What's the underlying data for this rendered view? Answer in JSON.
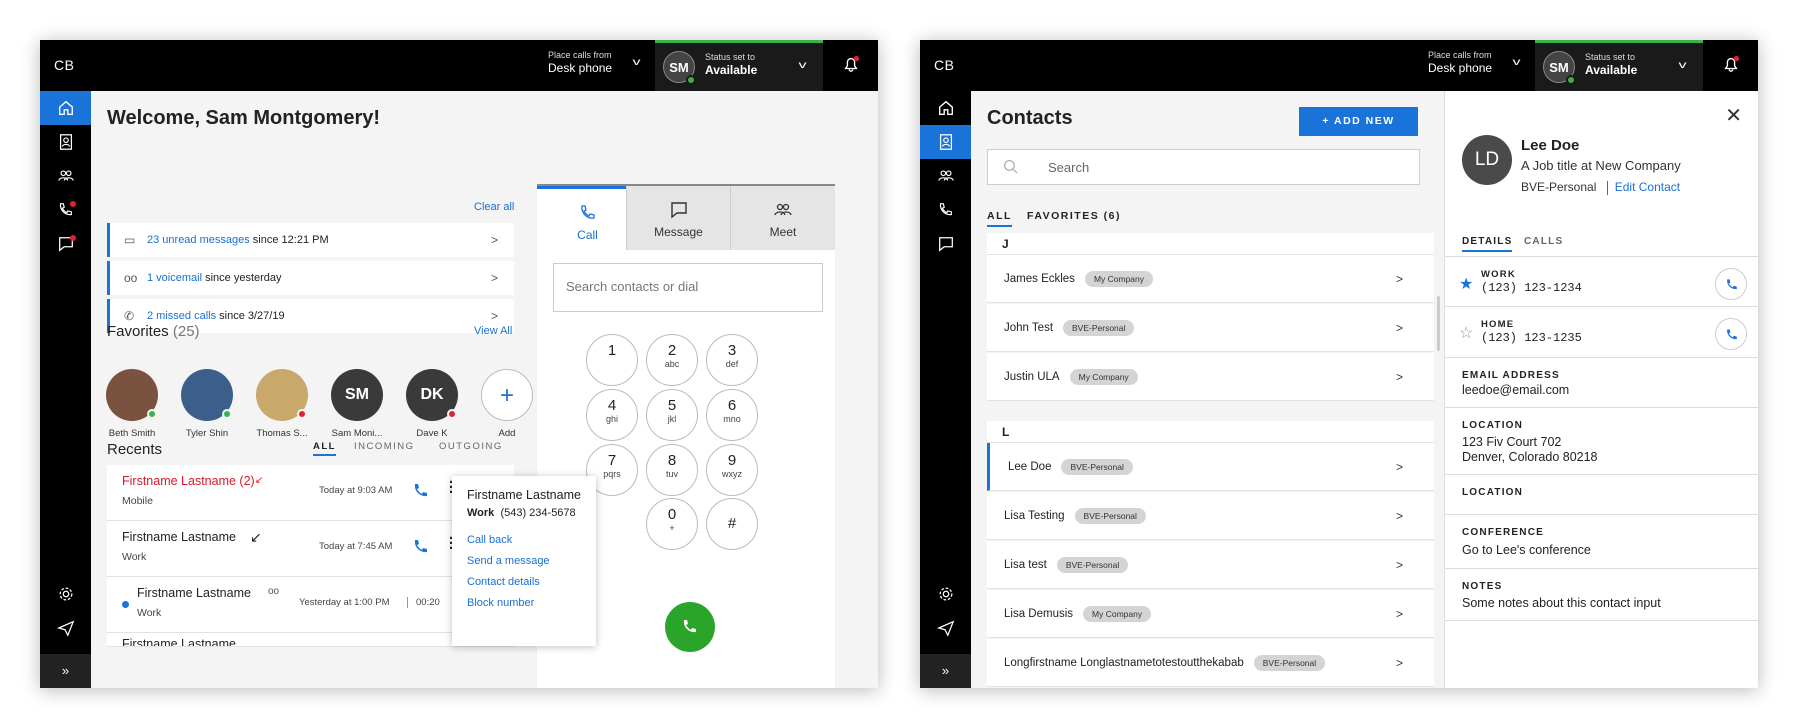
{
  "colors": {
    "accent": "#1a73d9",
    "available": "#3cb34a",
    "busy": "#e0212f",
    "call": "#2aa52a"
  },
  "left": {
    "logo": "CB",
    "place_label": "Place calls from",
    "place_value": "Desk phone",
    "status_initials": "SM",
    "status_label": "Status set to",
    "status_value": "Available",
    "welcome": "Welcome, Sam Montgomery!",
    "clear_all": "Clear all",
    "notifications": [
      {
        "link": "23 unread messages",
        "rest": "since 12:21 PM",
        "icon": "message-icon"
      },
      {
        "link": "1 voicemail",
        "rest": "since yesterday",
        "icon": "voicemail-icon"
      },
      {
        "link": "2 missed calls",
        "rest": "since 3/27/19",
        "icon": "missed-call-icon"
      }
    ],
    "favorites_title": "Favorites",
    "favorites_count": "(25)",
    "view_all": "View All",
    "favorites": [
      {
        "name": "Beth Smith",
        "status": "available"
      },
      {
        "name": "Tyler Shin",
        "status": "available"
      },
      {
        "name": "Thomas S...",
        "status": "busy"
      },
      {
        "name": "Sam Moni...",
        "initials": "SM"
      },
      {
        "name": "Dave K",
        "initials": "DK",
        "status": "busy"
      },
      {
        "name": "Add"
      }
    ],
    "recents_title": "Recents",
    "recent_tabs": [
      "ALL",
      "INCOMING",
      "OUTGOING"
    ],
    "recents": [
      {
        "name": "Firstname Lastname (2)",
        "type": "Mobile",
        "time": "Today at 9:03 AM"
      },
      {
        "name": "Firstname Lastname",
        "type": "Work",
        "time": "Today at 7:45 AM"
      },
      {
        "name": "Firstname Lastname",
        "type": "Work",
        "time": "Yesterday at 1:00 PM",
        "duration": "00:20"
      },
      {
        "name": "Firstname Lastname"
      }
    ],
    "popup": {
      "name": "Firstname Lastname",
      "type": "Work",
      "number": "(543) 234-5678",
      "actions": [
        "Call back",
        "Send a message",
        "Contact details",
        "Block number"
      ]
    },
    "dial_tabs": [
      "Call",
      "Message",
      "Meet"
    ],
    "dial_placeholder": "Search contacts or dial",
    "keys": [
      [
        "1",
        ""
      ],
      [
        "2",
        "abc"
      ],
      [
        "3",
        "def"
      ],
      [
        "4",
        "ghi"
      ],
      [
        "5",
        "jkl"
      ],
      [
        "6",
        "mno"
      ],
      [
        "7",
        "pqrs"
      ],
      [
        "8",
        "tuv"
      ],
      [
        "9",
        "wxyz"
      ],
      [
        "0",
        "+"
      ],
      [
        "#",
        ""
      ]
    ]
  },
  "right": {
    "logo": "CB",
    "place_label": "Place calls from",
    "place_value": "Desk phone",
    "status_initials": "SM",
    "status_label": "Status set to",
    "status_value": "Available",
    "title": "Contacts",
    "add_new": "+ ADD NEW",
    "search_placeholder": "Search",
    "tabs": [
      "ALL",
      "FAVORITES (6)"
    ],
    "groups": [
      {
        "letter": "J",
        "contacts": [
          {
            "name": "James Eckles",
            "tag": "My Company"
          },
          {
            "name": "John Test",
            "tag": "BVE-Personal"
          },
          {
            "name": "Justin ULA",
            "tag": "My Company"
          }
        ]
      },
      {
        "letter": "L",
        "contacts": [
          {
            "name": "Lee Doe",
            "tag": "BVE-Personal"
          },
          {
            "name": "Lisa Testing",
            "tag": "BVE-Personal"
          },
          {
            "name": "Lisa test",
            "tag": "BVE-Personal"
          },
          {
            "name": "Lisa Demusis",
            "tag": "My Company"
          },
          {
            "name": "Longfirstname Longlastnametotestoutthekabab",
            "tag": "BVE-Personal"
          }
        ]
      }
    ],
    "detail": {
      "initials": "LD",
      "name": "Lee Doe",
      "job": "A Job title at New Company",
      "group": "BVE-Personal",
      "edit": "Edit Contact",
      "tabs": [
        "DETAILS",
        "CALLS"
      ],
      "work_label": "WORK",
      "work": "(123) 123-1234",
      "home_label": "HOME",
      "home": "(123) 123-1235",
      "email_label": "EMAIL ADDRESS",
      "email": "leedoe@email.com",
      "location_label": "LOCATION",
      "address1": "123 Fiv Court 702",
      "address2": "Denver, Colorado 80218",
      "location2_label": "LOCATION",
      "conference_label": "CONFERENCE",
      "conference": "Go to Lee's conference",
      "notes_label": "NOTES",
      "notes": "Some notes about this contact input"
    }
  }
}
